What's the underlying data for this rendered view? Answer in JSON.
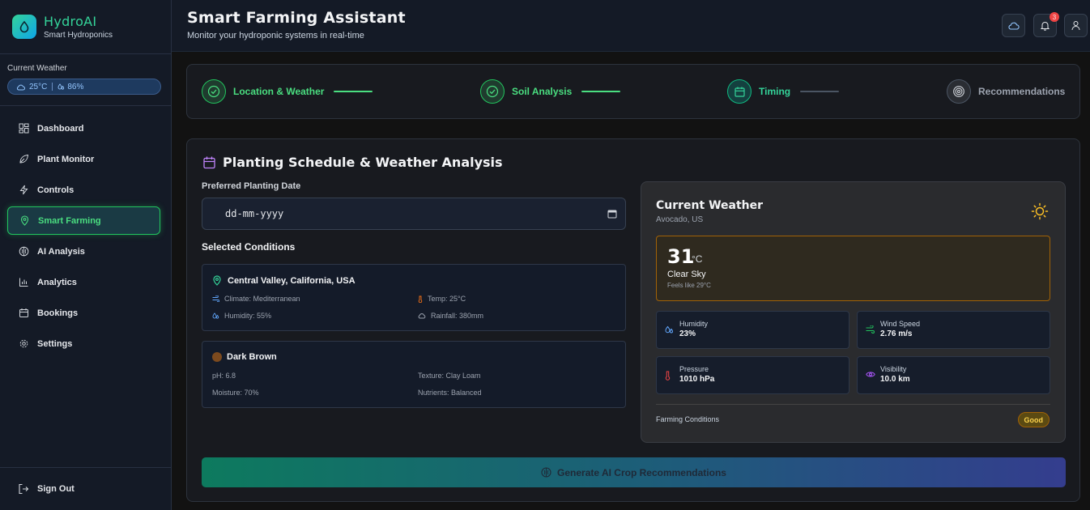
{
  "brand": {
    "name": "HydroAI",
    "subtitle": "Smart Hydroponics"
  },
  "sidebar_weather": {
    "title": "Current Weather",
    "temp": "25°C",
    "humidity": "86%"
  },
  "nav": {
    "items": [
      {
        "label": "Dashboard",
        "icon": "grid-icon"
      },
      {
        "label": "Plant Monitor",
        "icon": "leaf-icon"
      },
      {
        "label": "Controls",
        "icon": "lightning-icon"
      },
      {
        "label": "Smart Farming",
        "icon": "map-pin-icon",
        "active": true
      },
      {
        "label": "AI Analysis",
        "icon": "brain-icon"
      },
      {
        "label": "Analytics",
        "icon": "bar-chart-icon"
      },
      {
        "label": "Bookings",
        "icon": "calendar-icon"
      },
      {
        "label": "Settings",
        "icon": "gear-icon"
      }
    ],
    "sign_out": "Sign Out"
  },
  "header": {
    "title": "Smart Farming Assistant",
    "subtitle": "Monitor your hydroponic systems in real-time",
    "notification_count": "3"
  },
  "stepper": {
    "steps": [
      {
        "label": "Location & Weather",
        "state": "done"
      },
      {
        "label": "Soil Analysis",
        "state": "done"
      },
      {
        "label": "Timing",
        "state": "current"
      },
      {
        "label": "Recommendations",
        "state": "todo"
      }
    ]
  },
  "schedule": {
    "title": "Planting Schedule & Weather Analysis",
    "date_label": "Preferred Planting Date",
    "date_placeholder": "dd-mm-yyyy",
    "conditions_title": "Selected Conditions",
    "location": {
      "name": "Central Valley, California, USA",
      "climate": "Climate: Mediterranean",
      "temp": "Temp: 25°C",
      "humidity": "Humidity: 55%",
      "rainfall": "Rainfall: 380mm"
    },
    "soil": {
      "name": "Dark Brown",
      "color": "#7c4a1e",
      "ph": "pH: 6.8",
      "texture": "Texture: Clay Loam",
      "moisture": "Moisture: 70%",
      "nutrients": "Nutrients: Balanced"
    },
    "generate_label": "Generate AI Crop Recommendations"
  },
  "weather": {
    "title": "Current Weather",
    "location": "Avocado, US",
    "temp": "31",
    "unit": "°C",
    "condition": "Clear Sky",
    "feels_like": "Feels like 29°C",
    "humidity_label": "Humidity",
    "humidity_value": "23%",
    "wind_label": "Wind Speed",
    "wind_value": "2.76 m/s",
    "pressure_label": "Pressure",
    "pressure_value": "1010 hPa",
    "visibility_label": "Visibility",
    "visibility_value": "10.0 km",
    "farming_label": "Farming Conditions",
    "farming_value": "Good"
  },
  "colors": {
    "accent": "#34d399",
    "active_nav": "#22c55e",
    "warning": "#fbbf24"
  }
}
